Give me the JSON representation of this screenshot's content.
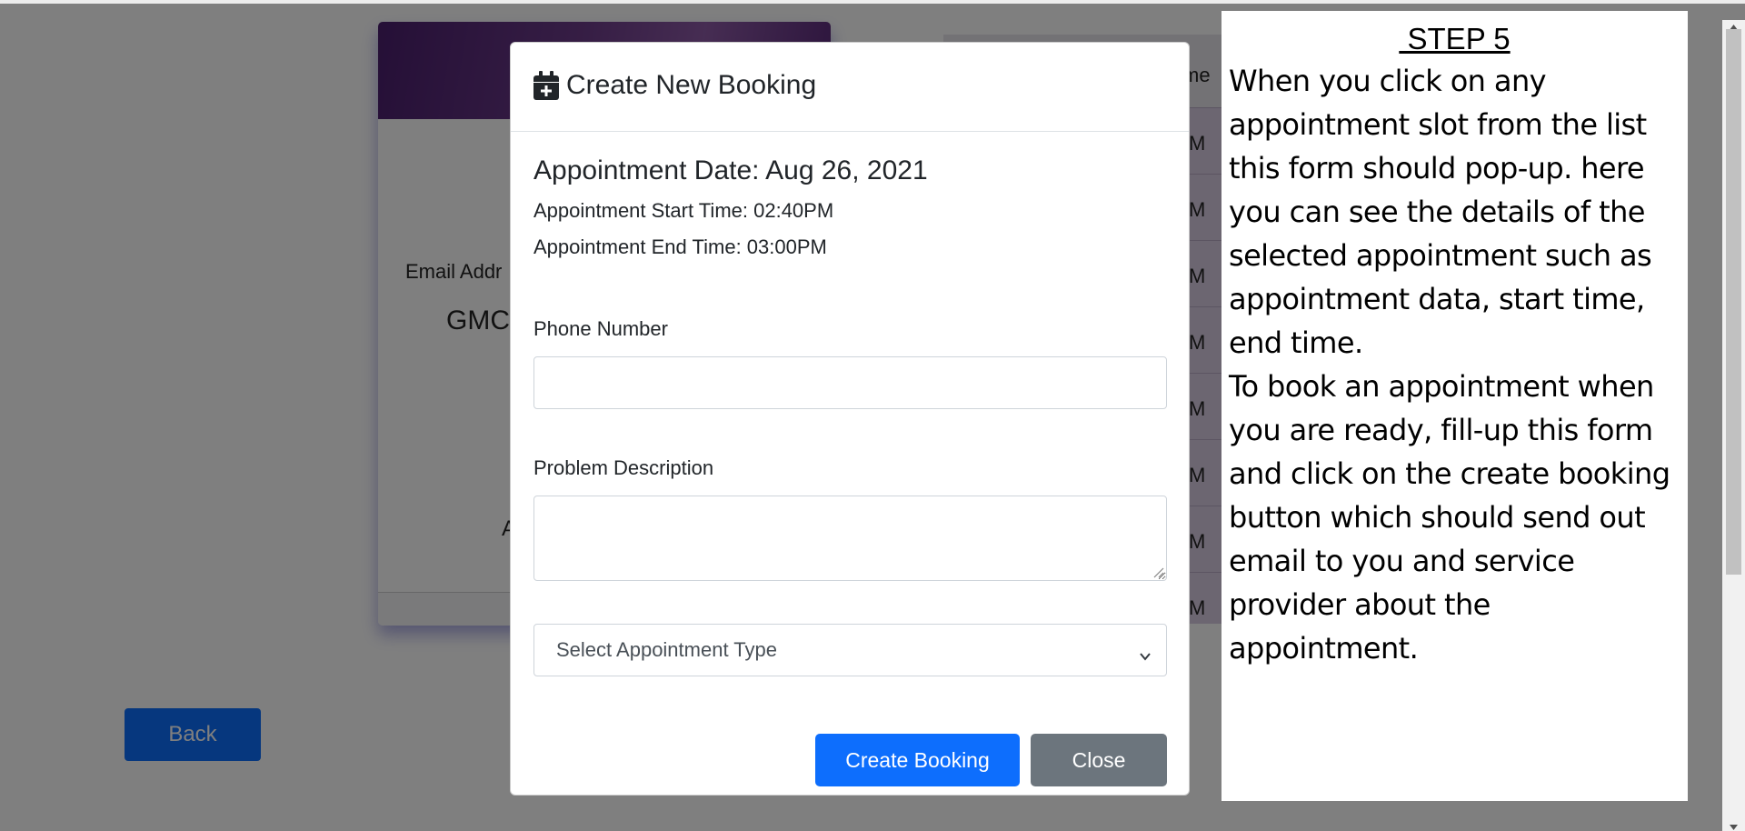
{
  "background": {
    "profile_card": {
      "email_label": "Email Addr",
      "company_name": "GMC",
      "address_fragment": "A"
    },
    "slots_table": {
      "header_fragment": "me",
      "row_suffixes": [
        "M",
        "M",
        "M",
        "M",
        "M",
        "M",
        "M",
        "M"
      ]
    },
    "back_button_label": "Back"
  },
  "modal": {
    "title": "Create New Booking",
    "title_icon": "calendar-plus-icon",
    "appointment_date": "Appointment Date: Aug 26, 2021",
    "appointment_start": "Appointment Start Time: 02:40PM",
    "appointment_end": "Appointment End Time: 03:00PM",
    "phone": {
      "label": "Phone Number",
      "value": ""
    },
    "description": {
      "label": "Problem Description",
      "value": ""
    },
    "appointment_type": {
      "selected": "Select Appointment Type"
    },
    "create_button_label": "Create Booking",
    "close_button_label": "Close",
    "primary_color": "#0d6efd",
    "secondary_color": "#6c757d"
  },
  "instructions": {
    "step_title": " STEP 5",
    "paragraph_1": "When you click on any appointment slot from the list this form should pop-up. here you can see the details of the selected appointment such as appointment data, start time, end time.",
    "paragraph_2": "To book an appointment when you are ready, fill-up this form and click on the create booking button which should send out email to you  and service provider about the appointment."
  }
}
